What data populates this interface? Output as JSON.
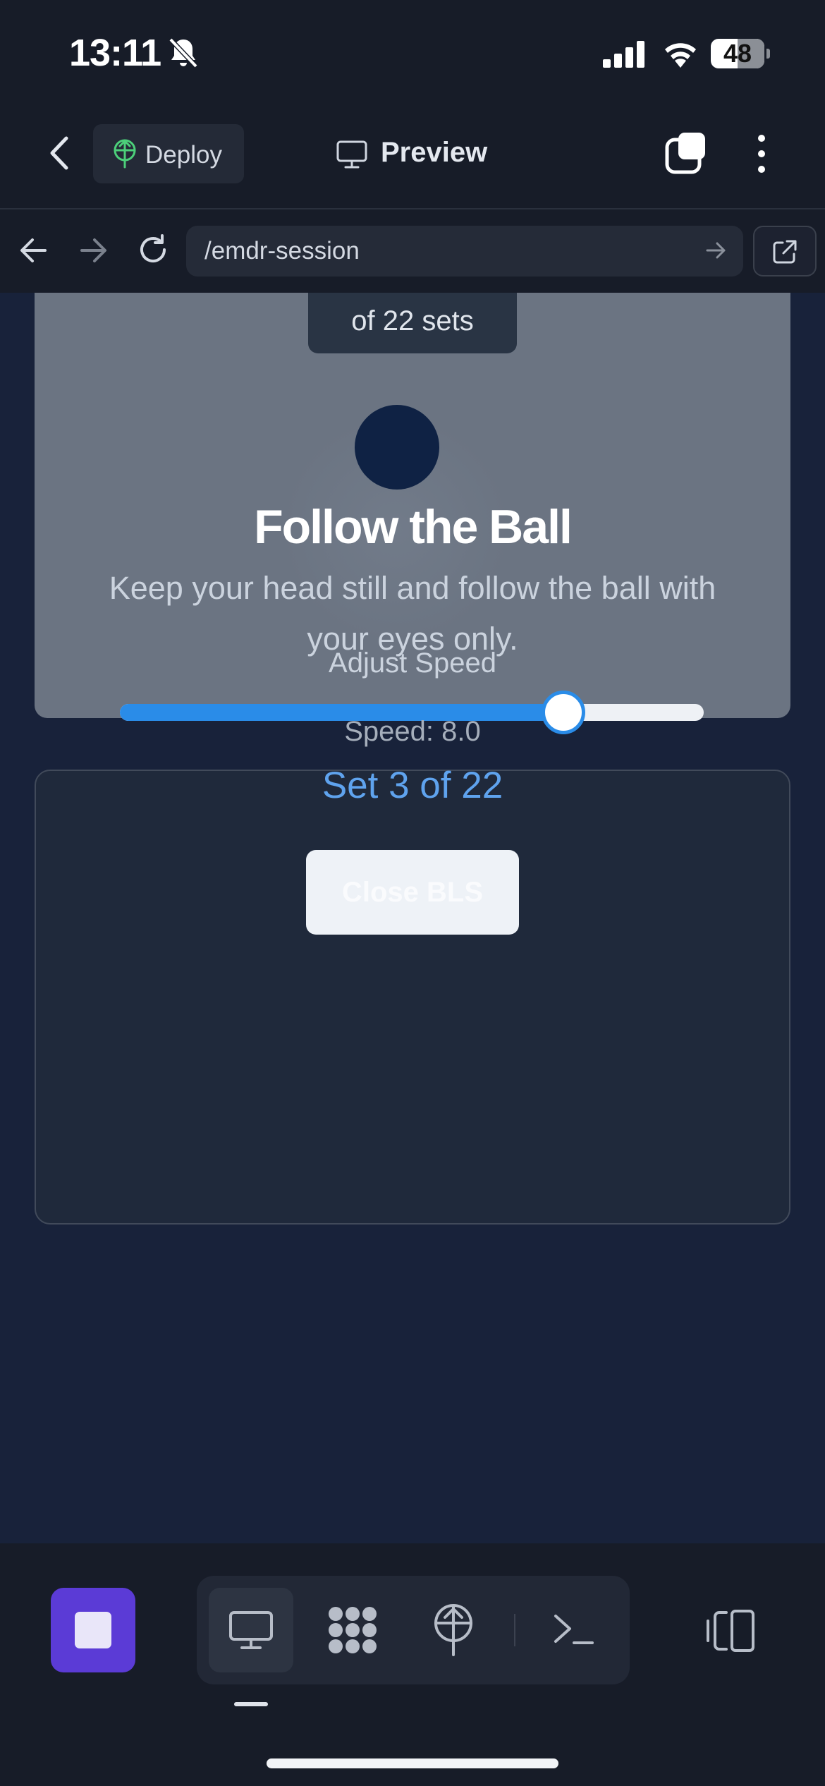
{
  "status_bar": {
    "time": "13:11",
    "battery": "48"
  },
  "app_bar": {
    "deploy_label": "Deploy",
    "preview_label": "Preview"
  },
  "url_bar": {
    "path": "/emdr-session"
  },
  "stage": {
    "sets_text": "of 22 sets"
  },
  "card": {
    "title": "Follow the Ball",
    "description": "Keep your head still and follow the ball with your eyes only.",
    "speed_label": "Adjust Speed",
    "speed_slider_fraction": 0.76,
    "speed_value_text": "Speed: 8.0",
    "set_progress": "Set 3 of 22",
    "close_button": "Close BLS"
  },
  "colors": {
    "accent_blue": "#2a8ce8",
    "set_text_blue": "#5fa3ee",
    "stop_purple": "#5b3bd6",
    "deploy_green": "#4ccf7a"
  },
  "icons": {
    "bell": "bell-slash-icon",
    "back": "chevron-left-icon",
    "deploy": "deploy-icon",
    "preview": "monitor-icon",
    "tabs": "tabs-icon",
    "menu": "more-vertical-icon",
    "nav_back": "arrow-left-icon",
    "nav_forward": "arrow-right-icon",
    "reload": "reload-icon",
    "go": "arrow-right-icon",
    "external": "external-link-icon",
    "apps": "apps-icon",
    "terminal": "terminal-icon",
    "panels": "panels-icon"
  }
}
